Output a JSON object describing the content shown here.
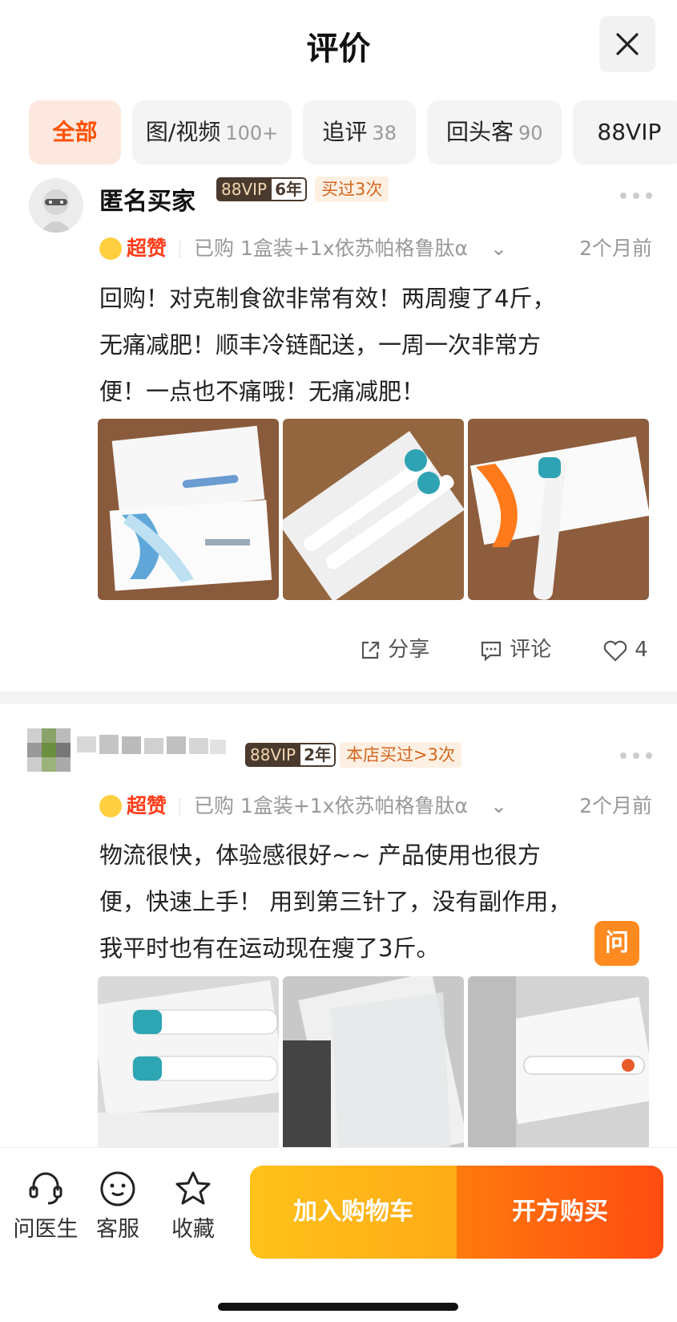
{
  "header": {
    "title": "评价",
    "close_icon": "close-icon"
  },
  "tabs": [
    {
      "label": "全部",
      "count": ""
    },
    {
      "label": "图/视频",
      "count": "100+"
    },
    {
      "label": "追评",
      "count": "38"
    },
    {
      "label": "回头客",
      "count": "90"
    },
    {
      "label": "88VIP",
      "count": ""
    }
  ],
  "reviews": [
    {
      "user": "匿名买家",
      "vip": "88VIP",
      "years": "6年",
      "purchase_badge": "买过3次",
      "praise": "超赞",
      "spec": "已购 1盒装+1x依苏帕格鲁肽α",
      "time": "2个月前",
      "text": [
        "回购！对克制食欲非常有效！两周瘦了4斤，",
        "无痛减肥！顺丰冷链配送，一周一次非常方",
        "便！一点也不痛哦！无痛减肥！"
      ],
      "actions": {
        "share": "分享",
        "comment": "评论",
        "likes": "4"
      }
    },
    {
      "user": "",
      "vip": "88VIP",
      "years": "2年",
      "purchase_badge": "本店买过>3次",
      "praise": "超赞",
      "spec": "已购 1盒装+1x依苏帕格鲁肽α",
      "time": "2个月前",
      "text": [
        "物流很快，体验感很好~~ 产品使用也很方",
        "便，快速上手！ 用到第三针了，没有副作用，",
        "我平时也有在运动现在瘦了3斤。"
      ]
    }
  ],
  "float_ask": "问",
  "bottom": {
    "ask_doctor": "问医生",
    "service": "客服",
    "favorite": "收藏",
    "add_cart": "加入购物车",
    "prescribe_buy": "开方购买"
  },
  "colors": {
    "accent": "#ff5000",
    "cart": "#ffb619",
    "buy": "#ff5a10"
  }
}
